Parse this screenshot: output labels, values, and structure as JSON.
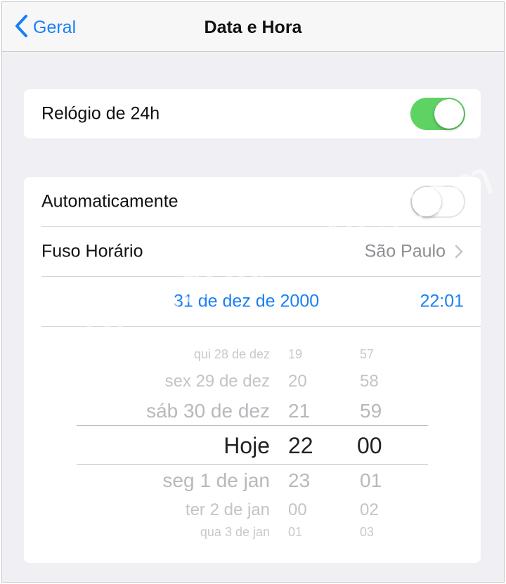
{
  "navbar": {
    "back_label": "Geral",
    "title": "Data e Hora"
  },
  "clock24": {
    "label": "Relógio de 24h",
    "enabled": true
  },
  "settings": {
    "auto_label": "Automaticamente",
    "auto_enabled": false,
    "timezone_label": "Fuso Horário",
    "timezone_value": "São Paulo",
    "date_value": "31 de dez de 2000",
    "time_value": "22:01"
  },
  "picker": {
    "day_rows": [
      "qui 28 de dez",
      "sex 29 de dez",
      "sáb 30 de dez",
      "Hoje",
      "seg 1 de jan",
      "ter 2 de jan",
      "qua 3 de jan"
    ],
    "hour_rows": [
      "19",
      "20",
      "21",
      "22",
      "23",
      "00",
      "01"
    ],
    "minute_rows": [
      "57",
      "58",
      "59",
      "00",
      "01",
      "02",
      "03"
    ],
    "selected_index": 3
  },
  "watermark": "blogdoiphone.com",
  "colors": {
    "accent": "#1a7ff5",
    "toggle_on": "#5ed262",
    "background": "#efeff4"
  }
}
